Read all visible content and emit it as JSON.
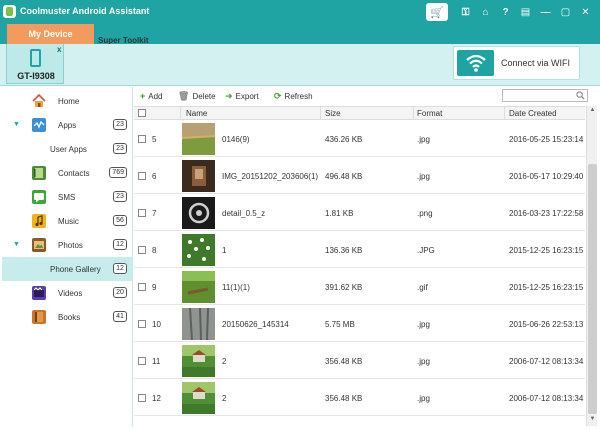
{
  "app": {
    "title": "Coolmuster Android Assistant"
  },
  "titlebar_icons": [
    "cart-icon",
    "key-icon",
    "home-icon",
    "help-icon",
    "feedback-icon",
    "minimize-icon",
    "maximize-icon",
    "close-icon"
  ],
  "titlebar_glyphs": {
    "cart": "🛒",
    "key": "⚿",
    "home": "⌂",
    "help": "?",
    "feedback": "▤",
    "minimize": "—",
    "maximize": "▢",
    "close": "✕"
  },
  "tabs": {
    "my_device": "My Device",
    "super_toolkit": "Super Toolkit"
  },
  "device": {
    "name": "GT-I9308",
    "close": "x"
  },
  "wifi": {
    "label": "Connect via WIFI"
  },
  "sidebar": {
    "items": [
      {
        "label": "Home",
        "count": "",
        "icon": "home-icon"
      },
      {
        "label": "Apps",
        "count": "23",
        "icon": "apps-icon",
        "expanded": true
      },
      {
        "label": "User Apps",
        "count": "23",
        "sub": true
      },
      {
        "label": "Contacts",
        "count": "769",
        "icon": "contacts-icon"
      },
      {
        "label": "SMS",
        "count": "23",
        "icon": "sms-icon"
      },
      {
        "label": "Music",
        "count": "56",
        "icon": "music-icon"
      },
      {
        "label": "Photos",
        "count": "12",
        "icon": "photos-icon",
        "expanded": true
      },
      {
        "label": "Phone Gallery",
        "count": "12",
        "sub": true,
        "selected": true
      },
      {
        "label": "Videos",
        "count": "20",
        "icon": "videos-icon"
      },
      {
        "label": "Books",
        "count": "41",
        "icon": "books-icon"
      }
    ]
  },
  "toolbar": {
    "add": "Add",
    "delete": "Delete",
    "export": "Export",
    "refresh": "Refresh",
    "search_placeholder": ""
  },
  "table": {
    "headers": {
      "name": "Name",
      "size": "Size",
      "format": "Format",
      "date": "Date Created"
    },
    "rows": [
      {
        "num": "5",
        "name": "0146(9)",
        "size": "436.26 KB",
        "format": ".jpg",
        "date": "2016-05-25 15:23:14",
        "thumb": "field"
      },
      {
        "num": "6",
        "name": "IMG_20151202_203606(1)",
        "size": "496.48 KB",
        "format": ".jpg",
        "date": "2016-05-17 10:29:40",
        "thumb": "dark-brown"
      },
      {
        "num": "7",
        "name": "detail_0.5_z",
        "size": "1.81 KB",
        "format": ".png",
        "date": "2016-03-23 17:22:58",
        "thumb": "gear-dark"
      },
      {
        "num": "8",
        "name": "1",
        "size": "136.36 KB",
        "format": ".JPG",
        "date": "2015-12-25 16:23:15",
        "thumb": "flowers"
      },
      {
        "num": "9",
        "name": "11(1)(1)",
        "size": "391.62 KB",
        "format": ".gif",
        "date": "2015-12-25 16:23:15",
        "thumb": "bench"
      },
      {
        "num": "10",
        "name": "20150626_145314",
        "size": "5.75 MB",
        "format": ".jpg",
        "date": "2015-06-26 22:53:13",
        "thumb": "gray-lines"
      },
      {
        "num": "11",
        "name": "2",
        "size": "356.48 KB",
        "format": ".jpg",
        "date": "2006-07-12 08:13:34",
        "thumb": "house"
      },
      {
        "num": "12",
        "name": "2",
        "size": "356.48 KB",
        "format": ".jpg",
        "date": "2006-07-12 08:13:34",
        "thumb": "house"
      }
    ]
  },
  "colors": {
    "accent": "#1fa3a3",
    "tab_active": "#f39a5e",
    "device_bar": "#d4f1f1",
    "selected": "#c6ecec"
  }
}
